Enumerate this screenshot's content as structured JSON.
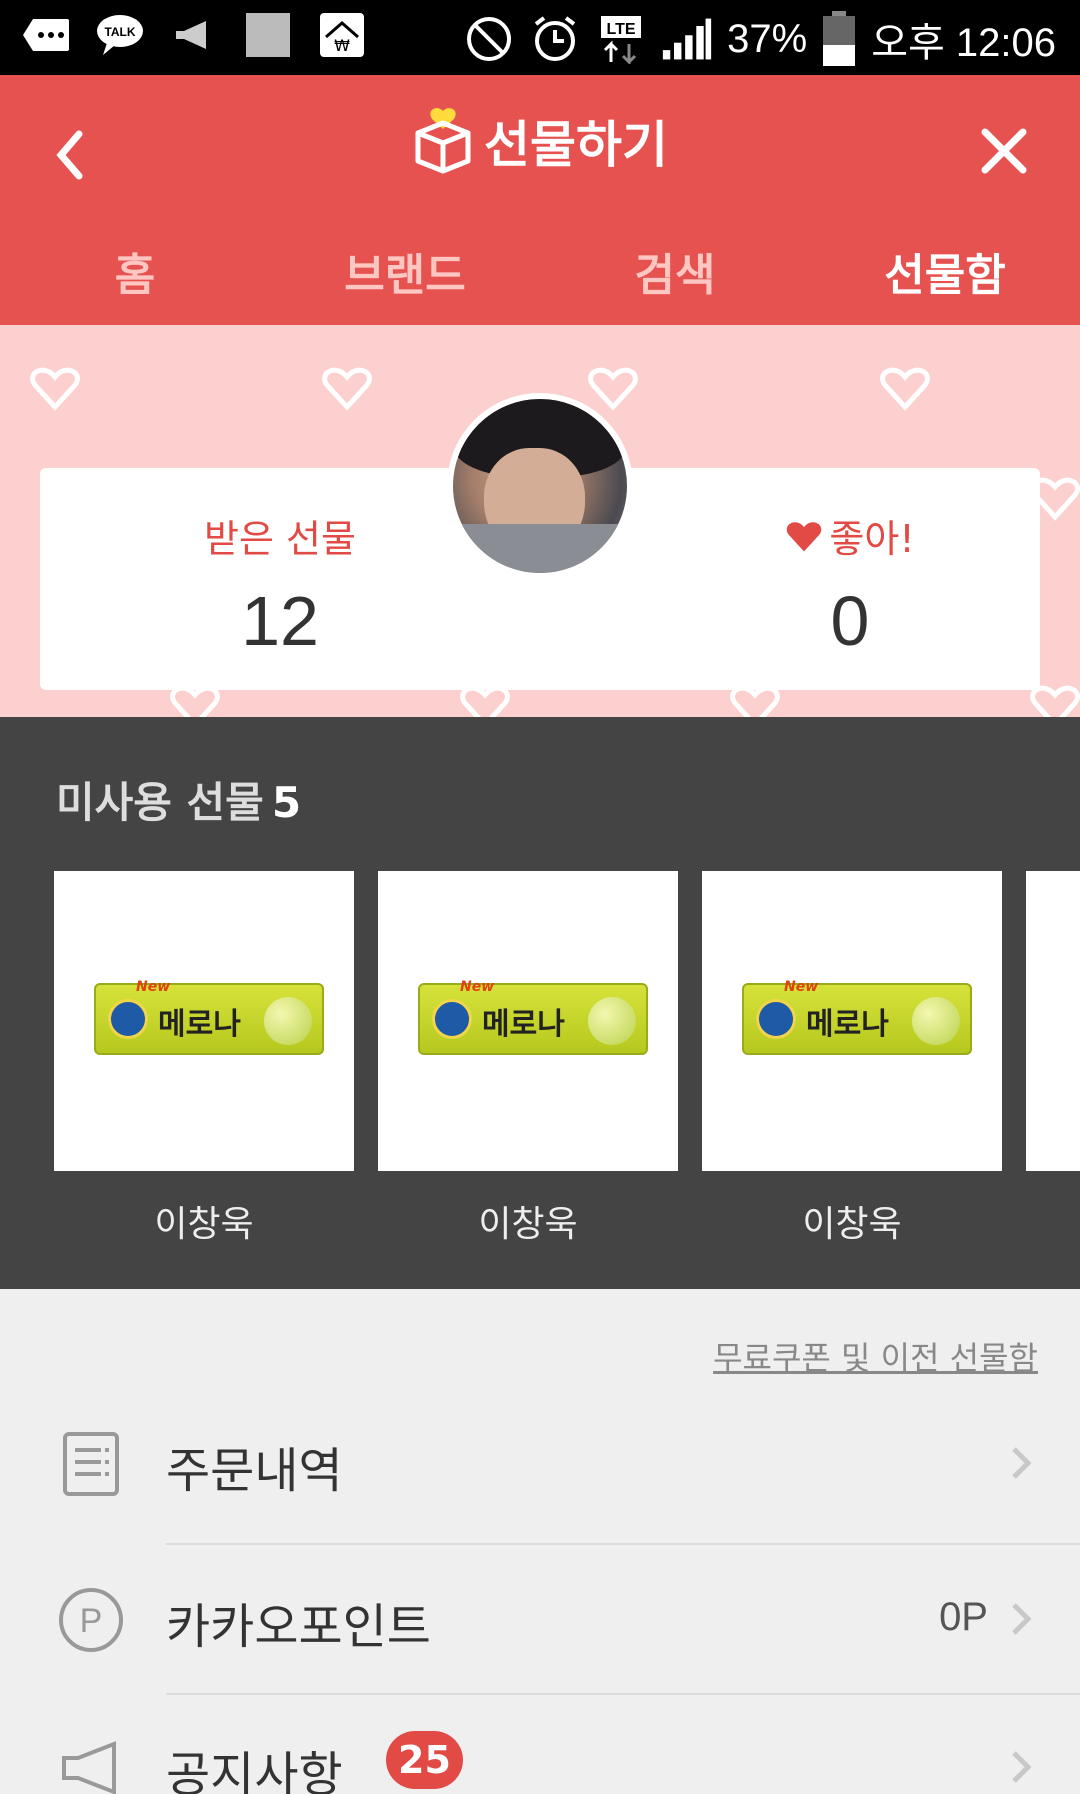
{
  "status_bar": {
    "battery": "37%",
    "time": "오후 12:06",
    "network": "LTE",
    "icons": [
      "more-icon",
      "kakaotalk-icon",
      "megaphone-icon",
      "image-icon",
      "shop-icon",
      "do-not-disturb-icon",
      "alarm-icon",
      "lte-icon",
      "signal-icon",
      "battery-icon"
    ]
  },
  "header": {
    "title": "선물하기",
    "back_icon": "chevron-left-icon",
    "close_icon": "close-icon",
    "accent_color": "#e6524f"
  },
  "tabs": [
    {
      "label": "홈",
      "active": false
    },
    {
      "label": "브랜드",
      "active": false
    },
    {
      "label": "검색",
      "active": false
    },
    {
      "label": "선물함",
      "active": true
    }
  ],
  "profile": {
    "received_label": "받은 선물",
    "received_count": "12",
    "like_label": "좋아!",
    "like_count": "0"
  },
  "unused": {
    "title": "미사용 선물",
    "count": "5",
    "gifts": [
      {
        "product": "메로나",
        "sender": "이창욱"
      },
      {
        "product": "메로나",
        "sender": "이창욱"
      },
      {
        "product": "메로나",
        "sender": "이창욱"
      }
    ]
  },
  "coupon_link": "무료쿠폰 및 이전 선물함",
  "menu": [
    {
      "label": "주문내역",
      "icon": "receipt-icon",
      "value": "",
      "badge": ""
    },
    {
      "label": "카카오포인트",
      "icon": "point-icon",
      "value": "0P",
      "badge": ""
    },
    {
      "label": "공지사항",
      "icon": "megaphone-icon",
      "value": "",
      "badge": "25"
    }
  ]
}
